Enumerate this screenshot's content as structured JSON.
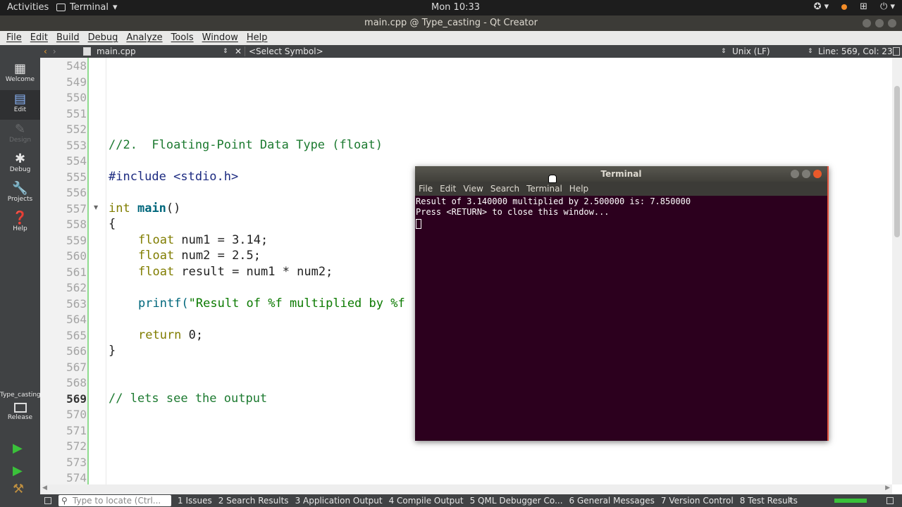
{
  "topbar": {
    "activities": "Activities",
    "app_menu": "Terminal",
    "clock": "Mon 10:33",
    "tray_icons": [
      "accessibility-icon",
      "notification-dot-icon",
      "network-icon",
      "power-icon"
    ]
  },
  "window_title": "main.cpp @ Type_casting - Qt Creator",
  "menubar": [
    "File",
    "Edit",
    "Build",
    "Debug",
    "Analyze",
    "Tools",
    "Window",
    "Help"
  ],
  "editor_toolbar": {
    "file": "main.cpp",
    "symbol": "<Select Symbol>",
    "line_ending": "Unix (LF)",
    "position": "Line: 569, Col: 23"
  },
  "modes": [
    {
      "label": "Welcome",
      "icon": "grid-icon"
    },
    {
      "label": "Edit",
      "icon": "document-icon",
      "active": true
    },
    {
      "label": "Design",
      "icon": "pencil-icon",
      "disabled": true
    },
    {
      "label": "Debug",
      "icon": "bug-icon"
    },
    {
      "label": "Projects",
      "icon": "wrench-icon"
    },
    {
      "label": "Help",
      "icon": "help-icon"
    }
  ],
  "kit": {
    "project": "Type_casting",
    "build": "Release"
  },
  "line_numbers": [
    "548",
    "549",
    "550",
    "551",
    "552",
    "553",
    "554",
    "555",
    "556",
    "557",
    "558",
    "559",
    "560",
    "561",
    "562",
    "563",
    "564",
    "565",
    "566",
    "567",
    "568",
    "569",
    "570",
    "571",
    "572",
    "573",
    "574"
  ],
  "current_line": "569",
  "code": {
    "l553": "//2.  Floating-Point Data Type (float)",
    "l555a": "#include ",
    "l555b": "<stdio.h>",
    "l557_kw": "int",
    "l557_fn": "main",
    "l557_rest": "()",
    "l558": "{",
    "l559_kw": "float",
    "l559_rest": " num1 = 3.14;",
    "l560_kw": "float",
    "l560_rest": " num2 = 2.5;",
    "l561_kw": "float",
    "l561_rest": " result = num1 * num2;",
    "l563_fn": "printf(",
    "l563_str": "\"Result of %f multiplied by %f",
    "l565_kw": "return",
    "l565_rest": " 0;",
    "l566": "}",
    "l569": "// lets see the output"
  },
  "terminal": {
    "title": "Terminal",
    "menu": [
      "File",
      "Edit",
      "View",
      "Search",
      "Terminal",
      "Help"
    ],
    "output_line1": "Result of 3.140000 multiplied by 2.500000 is: 7.850000",
    "output_line2": "Press <RETURN> to close this window..."
  },
  "statusbar": {
    "locate_placeholder": "Type to locate (Ctrl...",
    "tabs": [
      "1  Issues",
      "2  Search Results",
      "3  Application Output",
      "4  Compile Output",
      "5  QML Debugger Co...",
      "6  General Messages",
      "7  Version Control",
      "8  Test Results"
    ]
  },
  "colors": {
    "terminal_bg": "#2c001e",
    "sidebar_bg": "#404244",
    "comment": "#1c7a30",
    "keyword": "#807d00",
    "function": "#00677c"
  }
}
